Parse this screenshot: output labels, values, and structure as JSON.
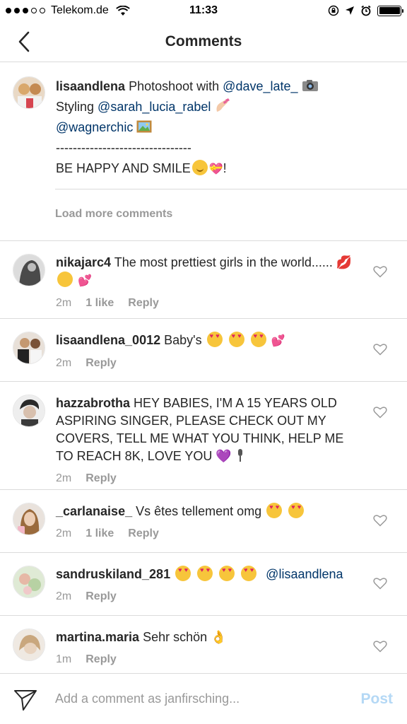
{
  "status_bar": {
    "carrier": "Telekom.de",
    "time": "11:33"
  },
  "nav": {
    "title": "Comments",
    "back_icon": "chevron-left-icon"
  },
  "caption": {
    "username": "lisaandlena",
    "line1_text": "Photoshoot with",
    "line1_mention": "@dave_late_",
    "line2_text": "Styling",
    "line2_mention": "@sarah_lucia_rabel",
    "line3_mention": "@wagnerchic",
    "divider": "--------------------------------",
    "closing_text": "BE HAPPY AND SMILE",
    "closing_end": "!"
  },
  "load_more": "Load more comments",
  "comments": [
    {
      "username": "nikajarc4",
      "text": "The most prettiest girls in the world......",
      "time": "2m",
      "likes": "1 like",
      "reply": "Reply"
    },
    {
      "username": "lisaandlena_0012",
      "text": "Baby's",
      "time": "2m",
      "reply": "Reply"
    },
    {
      "username": "hazzabrotha",
      "text": "HEY BABIES, I'M A 15 YEARS OLD ASPIRING SINGER, PLEASE CHECK OUT MY COVERS, TELL ME WHAT YOU THINK, HELP ME TO REACH 8K, LOVE YOU",
      "time": "2m",
      "reply": "Reply"
    },
    {
      "username": "_carlanaise_",
      "text": "Vs êtes tellement omg",
      "time": "2m",
      "likes": "1 like",
      "reply": "Reply"
    },
    {
      "username": "sandruskiland_281",
      "mention": "@lisaandlena",
      "time": "2m",
      "reply": "Reply"
    },
    {
      "username": "martina.maria",
      "text": "Sehr schön",
      "time": "1m",
      "reply": "Reply"
    }
  ],
  "input": {
    "placeholder": "Add a comment as janfirsching...",
    "post_label": "Post"
  },
  "colors": {
    "mention": "#003569",
    "muted": "#999999",
    "post_disabled": "#b4d8f5"
  }
}
